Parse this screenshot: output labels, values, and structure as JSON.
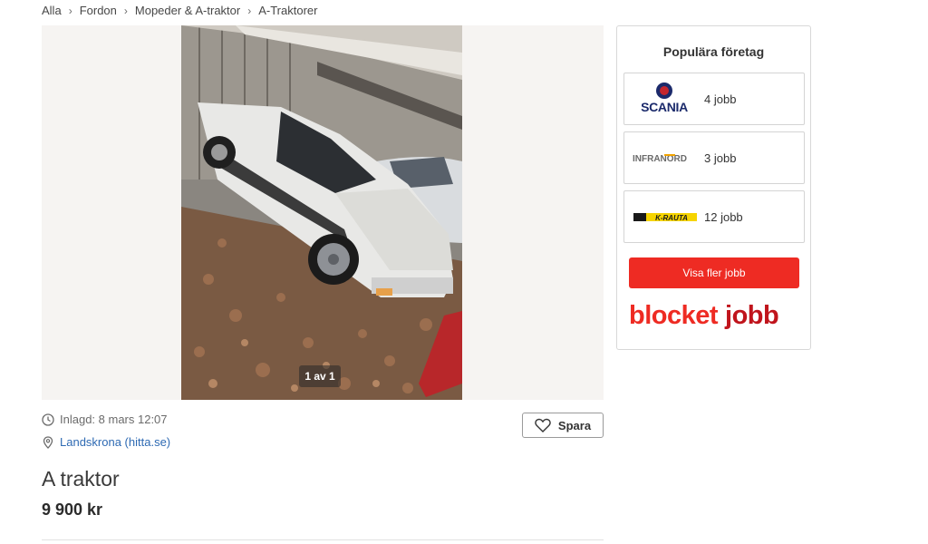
{
  "breadcrumb": [
    "Alla",
    "Fordon",
    "Mopeder & A-traktor",
    "A-Traktorer"
  ],
  "gallery": {
    "counter": "1 av 1"
  },
  "listing": {
    "posted": "Inlagd: 8 mars 12:07",
    "location": "Landskrona (hitta.se)",
    "save_label": "Spara",
    "title": "A traktor",
    "price": "9 900 kr"
  },
  "sidebar": {
    "heading": "Populära företag",
    "companies": [
      {
        "logo_text": "SCANIA",
        "jobs": "4 jobb",
        "icon": "scania-logo"
      },
      {
        "logo_text": "INFRANORD",
        "jobs": "3 jobb",
        "icon": "infranord-logo"
      },
      {
        "logo_text": "K-RAUTA",
        "jobs": "12 jobb",
        "icon": "k-rauta-logo"
      }
    ],
    "more_label": "Visa fler jobb",
    "brand_left": "blocket",
    "brand_right": "jobb"
  },
  "colors": {
    "accent_red": "#ee2b23",
    "link_blue": "#2e6ab3"
  }
}
